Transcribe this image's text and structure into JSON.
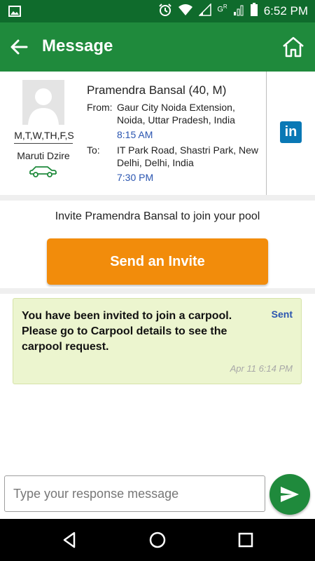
{
  "status": {
    "time": "6:52 PM",
    "network_label": "G",
    "network_sup": "R"
  },
  "appbar": {
    "title": "Message"
  },
  "profile": {
    "name": "Pramendra Bansal (40, M)",
    "days": "M,T,W,TH,F,S",
    "car": "Maruti Dzire",
    "from_label": "From:",
    "from_address": "Gaur City Noida Extension, Noida, Uttar Pradesh, India",
    "from_time": "8:15 AM",
    "to_label": "To:",
    "to_address": "IT Park Road, Shastri Park, New Delhi, Delhi, India",
    "to_time": "7:30 PM",
    "linkedin_text": "in"
  },
  "invite": {
    "prompt": "Invite Pramendra Bansal to join your pool",
    "button_label": "Send an Invite"
  },
  "message": {
    "text": "You have been invited to join a carpool. Please go to Carpool details to see the carpool request.",
    "status": "Sent",
    "timestamp": "Apr 11 6:14 PM"
  },
  "composer": {
    "placeholder": "Type your response message"
  },
  "colors": {
    "statusbar": "#0f6b2c",
    "appbar": "#1f8a3c",
    "invite_button": "#f28c0b",
    "message_bubble": "#ecf5cf",
    "link_blue": "#2a55b0"
  }
}
